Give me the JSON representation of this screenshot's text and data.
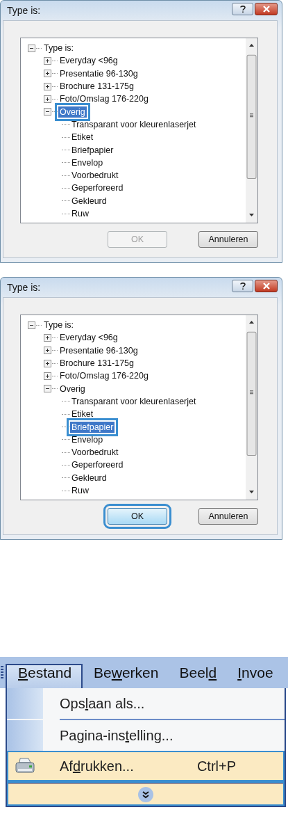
{
  "dialogs": [
    {
      "title": "Type is:",
      "tree": {
        "label": "Type is:",
        "expanded": true,
        "selected": false,
        "children": [
          {
            "label": "Everyday <96g",
            "expanded": false,
            "selected": false
          },
          {
            "label": "Presentatie 96-130g",
            "expanded": false,
            "selected": false
          },
          {
            "label": "Brochure 131-175g",
            "expanded": false,
            "selected": false
          },
          {
            "label": "Foto/Omslag 176-220g",
            "expanded": false,
            "selected": false
          },
          {
            "label": "Overig",
            "expanded": true,
            "selected": true,
            "children": [
              {
                "label": "Transparant voor kleurenlaserjet",
                "selected": false
              },
              {
                "label": "Etiket",
                "selected": false
              },
              {
                "label": "Briefpapier",
                "selected": false
              },
              {
                "label": "Envelop",
                "selected": false
              },
              {
                "label": "Voorbedrukt",
                "selected": false
              },
              {
                "label": "Geperforeerd",
                "selected": false
              },
              {
                "label": "Gekleurd",
                "selected": false
              },
              {
                "label": "Ruw",
                "selected": false
              }
            ]
          }
        ]
      },
      "buttons": [
        {
          "label": "OK",
          "disabled": true,
          "focused": false
        },
        {
          "label": "Annuleren",
          "disabled": false,
          "focused": false
        }
      ]
    },
    {
      "title": "Type is:",
      "tree": {
        "label": "Type is:",
        "expanded": true,
        "selected": false,
        "children": [
          {
            "label": "Everyday <96g",
            "expanded": false,
            "selected": false
          },
          {
            "label": "Presentatie 96-130g",
            "expanded": false,
            "selected": false
          },
          {
            "label": "Brochure 131-175g",
            "expanded": false,
            "selected": false
          },
          {
            "label": "Foto/Omslag 176-220g",
            "expanded": false,
            "selected": false
          },
          {
            "label": "Overig",
            "expanded": true,
            "selected": false,
            "children": [
              {
                "label": "Transparant voor kleurenlaserjet",
                "selected": false
              },
              {
                "label": "Etiket",
                "selected": false
              },
              {
                "label": "Briefpapier",
                "selected": true
              },
              {
                "label": "Envelop",
                "selected": false
              },
              {
                "label": "Voorbedrukt",
                "selected": false
              },
              {
                "label": "Geperforeerd",
                "selected": false
              },
              {
                "label": "Gekleurd",
                "selected": false
              },
              {
                "label": "Ruw",
                "selected": false
              }
            ]
          }
        ]
      },
      "buttons": [
        {
          "label": "OK",
          "disabled": false,
          "focused": true
        },
        {
          "label": "Annuleren",
          "disabled": false,
          "focused": false
        }
      ]
    }
  ],
  "menu": {
    "menubar": [
      {
        "parts": {
          "key": "B",
          "after": "estand"
        },
        "selected": true
      },
      {
        "parts": {
          "before": "Be",
          "key": "w",
          "after": "erken"
        },
        "selected": false
      },
      {
        "parts": {
          "before": "Beel",
          "key": "d"
        },
        "selected": false
      },
      {
        "parts": {
          "key": "I",
          "after": "nvoe"
        },
        "selected": false
      }
    ],
    "items": [
      {
        "kind": "item",
        "parts": {
          "before": "Ops",
          "key": "l",
          "after": "aan als..."
        },
        "highlighted": false
      },
      {
        "kind": "separator"
      },
      {
        "kind": "item",
        "parts": {
          "before": "Pagina-ins",
          "key": "t",
          "after": "elling..."
        },
        "highlighted": false
      },
      {
        "kind": "print_item",
        "parts": {
          "before": "Af",
          "key": "d",
          "after": "rukken..."
        },
        "shortcut": "Ctrl+P",
        "highlighted": true
      },
      {
        "kind": "expand",
        "highlighted": true
      }
    ]
  }
}
